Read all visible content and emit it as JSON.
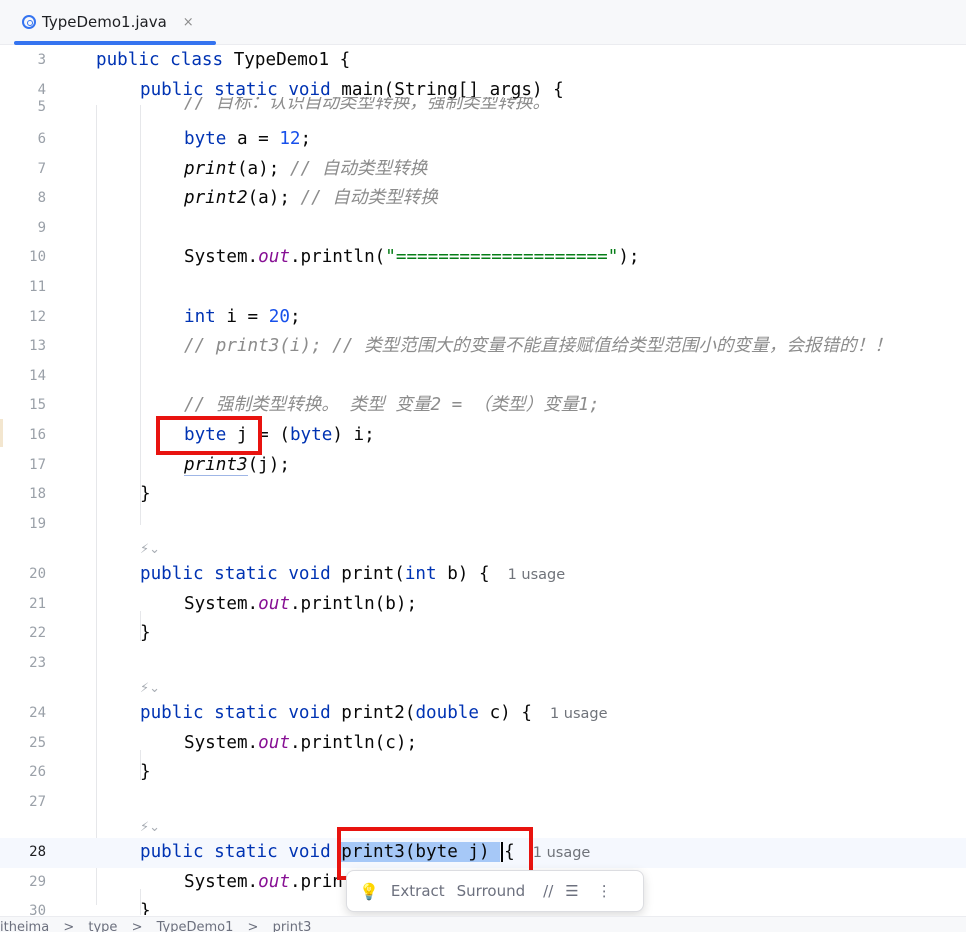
{
  "tab": {
    "title": "TypeDemo1.java",
    "icon": "java-class-icon",
    "close": "×"
  },
  "lines": {
    "l3": {
      "n": "3",
      "c": [
        "public",
        "class",
        "TypeDemo1 {"
      ]
    },
    "l4": {
      "n": "4",
      "c": [
        "public",
        "static",
        "void",
        "main(String[] args) {"
      ]
    },
    "l5": {
      "n": "5",
      "c": [
        "// 目标：认识自动类型转换，强制类型转换。"
      ]
    },
    "l6": {
      "n": "6",
      "c": [
        "byte",
        "a = ",
        "12",
        ";"
      ]
    },
    "l7": {
      "n": "7",
      "c": [
        "print",
        "(a); ",
        "// 自动类型转换"
      ]
    },
    "l8": {
      "n": "8",
      "c": [
        "print2",
        "(a); ",
        "// 自动类型转换"
      ]
    },
    "l9": {
      "n": "9"
    },
    "l10": {
      "n": "10",
      "c": [
        "System.",
        "out",
        ".println(",
        "\"====================\"",
        ");"
      ]
    },
    "l11": {
      "n": "11"
    },
    "l12": {
      "n": "12",
      "c": [
        "int",
        "i = ",
        "20",
        ";"
      ]
    },
    "l13": {
      "n": "13",
      "c": [
        "// print3(i); // 类型范围大的变量不能直接赋值给类型范围小的变量，会报错的！！"
      ]
    },
    "l14": {
      "n": "14"
    },
    "l15": {
      "n": "15",
      "c": [
        "// 强制类型转换。 类型 变量2 = （类型）变量1;"
      ]
    },
    "l16": {
      "n": "16",
      "c": [
        "byte",
        "j = (",
        "byte",
        ") i;"
      ]
    },
    "l17": {
      "n": "17",
      "c": [
        "print3",
        "(j);"
      ]
    },
    "l18": {
      "n": "18",
      "c": [
        "}"
      ]
    },
    "l19": {
      "n": "19"
    },
    "l20": {
      "n": "20",
      "c": [
        "public",
        "static",
        "void",
        "print(",
        "int",
        "b) {"
      ],
      "hint": "1 usage"
    },
    "l21": {
      "n": "21",
      "c": [
        "System.",
        "out",
        ".println(b);"
      ]
    },
    "l22": {
      "n": "22",
      "c": [
        "}"
      ]
    },
    "l23": {
      "n": "23"
    },
    "l24": {
      "n": "24",
      "c": [
        "public",
        "static",
        "void",
        "print2(",
        "double",
        "c) {"
      ],
      "hint": "1 usage"
    },
    "l25": {
      "n": "25",
      "c": [
        "System.",
        "out",
        ".println(c);"
      ]
    },
    "l26": {
      "n": "26",
      "c": [
        "}"
      ]
    },
    "l27": {
      "n": "27"
    },
    "l28": {
      "n": "28",
      "c": [
        "public",
        "static",
        "void",
        "print3(byte j) ",
        "{"
      ],
      "hint": "1 usage"
    },
    "l29": {
      "n": "29",
      "c": [
        "System.",
        "out",
        ".prin"
      ]
    },
    "l30": {
      "n": "30",
      "c": [
        "}"
      ]
    }
  },
  "lens_glyph": "⚡︎⌄",
  "popup": {
    "bulb": "💡",
    "extract": "Extract",
    "surround": "Surround",
    "comment": "//",
    "format": "☰",
    "more": "⋮"
  },
  "breadcrumb": {
    "items": [
      "itheima",
      ">",
      "type",
      ">",
      "TypeDemo1",
      ">",
      "print3"
    ]
  },
  "colors": {
    "keyword": "#0033b3",
    "number": "#1750eb",
    "string": "#067d17",
    "comment": "#8c8c8c",
    "field": "#871094",
    "highlight": "#e8130f",
    "selection": "#a6c8f7",
    "tab_underline": "#3574f0"
  }
}
